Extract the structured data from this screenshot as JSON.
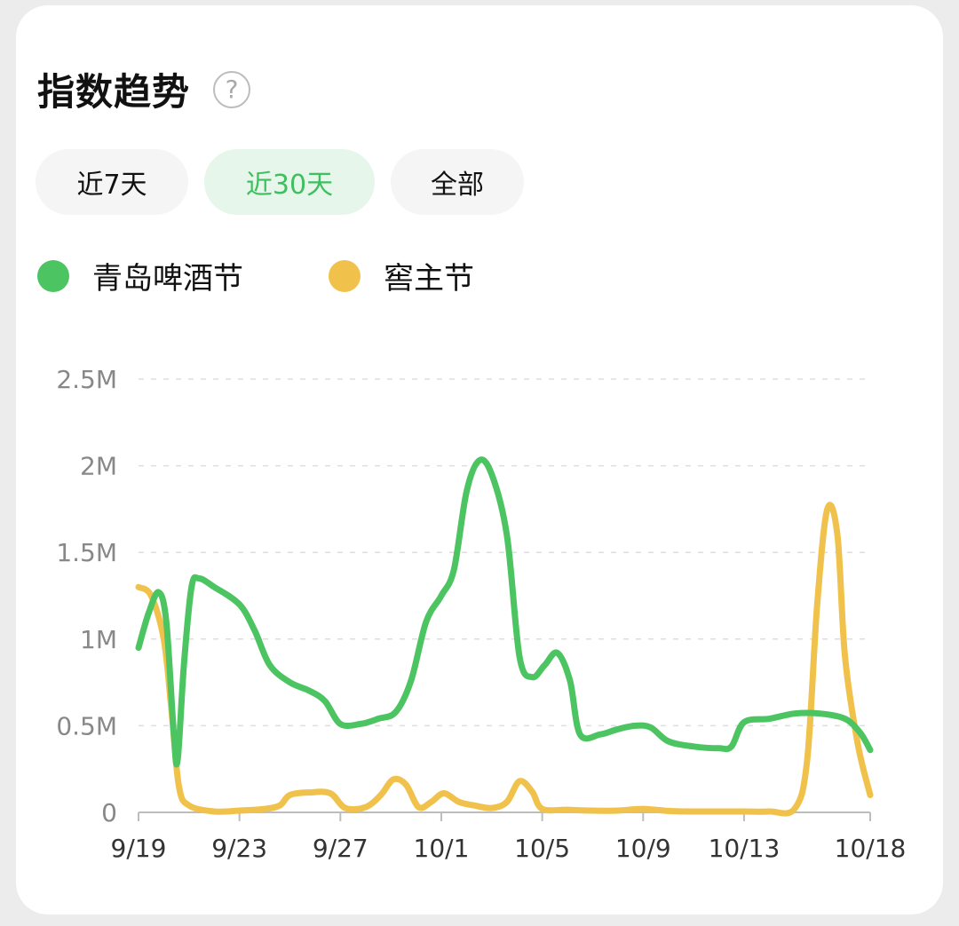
{
  "header": {
    "title": "指数趋势",
    "help_symbol": "?"
  },
  "tabs": [
    {
      "label": "近7天",
      "active": false
    },
    {
      "label": "近30天",
      "active": true
    },
    {
      "label": "全部",
      "active": false
    }
  ],
  "colors": {
    "green": "#4cc461",
    "yellow": "#f0c24b",
    "active_tab_text": "#3fbf5f"
  },
  "chart_data": {
    "type": "line",
    "y_ticks": [
      "0",
      "0.5M",
      "1M",
      "1.5M",
      "2M",
      "2.5M"
    ],
    "y_tick_values": [
      0,
      500000,
      1000000,
      1500000,
      2000000,
      2500000
    ],
    "ylim": [
      0,
      2500000
    ],
    "x_ticks": [
      "9/19",
      "9/23",
      "9/27",
      "10/1",
      "10/5",
      "10/9",
      "10/13",
      "10/18"
    ],
    "x_tick_days": [
      0,
      4,
      8,
      12,
      16,
      20,
      24,
      29
    ],
    "xlim": [
      0,
      29
    ],
    "grid": true,
    "legend_position": "top-left",
    "series": [
      {
        "name": "青岛啤酒节",
        "color": "#4cc461",
        "points": [
          [
            0,
            950000
          ],
          [
            0.4,
            1150000
          ],
          [
            0.8,
            1270000
          ],
          [
            1.1,
            1100000
          ],
          [
            1.4,
            450000
          ],
          [
            1.55,
            300000
          ],
          [
            1.8,
            850000
          ],
          [
            2.1,
            1300000
          ],
          [
            2.4,
            1350000
          ],
          [
            3,
            1300000
          ],
          [
            4,
            1200000
          ],
          [
            4.6,
            1050000
          ],
          [
            5.2,
            850000
          ],
          [
            6,
            750000
          ],
          [
            6.8,
            700000
          ],
          [
            7.4,
            640000
          ],
          [
            8,
            510000
          ],
          [
            8.8,
            510000
          ],
          [
            9.5,
            540000
          ],
          [
            10.2,
            580000
          ],
          [
            10.8,
            760000
          ],
          [
            11.4,
            1100000
          ],
          [
            12,
            1250000
          ],
          [
            12.5,
            1400000
          ],
          [
            13,
            1850000
          ],
          [
            13.5,
            2030000
          ],
          [
            14,
            1950000
          ],
          [
            14.6,
            1600000
          ],
          [
            15.1,
            900000
          ],
          [
            15.6,
            780000
          ],
          [
            16.1,
            850000
          ],
          [
            16.6,
            920000
          ],
          [
            17.1,
            760000
          ],
          [
            17.5,
            450000
          ],
          [
            18.3,
            450000
          ],
          [
            19,
            480000
          ],
          [
            19.7,
            500000
          ],
          [
            20.3,
            490000
          ],
          [
            21,
            410000
          ],
          [
            22,
            380000
          ],
          [
            23,
            370000
          ],
          [
            23.5,
            380000
          ],
          [
            24,
            520000
          ],
          [
            25,
            540000
          ],
          [
            26,
            570000
          ],
          [
            27,
            570000
          ],
          [
            28,
            540000
          ],
          [
            28.6,
            460000
          ],
          [
            29,
            360000
          ]
        ]
      },
      {
        "name": "窖主节",
        "color": "#f0c24b",
        "points": [
          [
            0,
            1300000
          ],
          [
            0.5,
            1250000
          ],
          [
            1,
            1000000
          ],
          [
            1.3,
            600000
          ],
          [
            1.6,
            150000
          ],
          [
            2,
            40000
          ],
          [
            3,
            5000
          ],
          [
            4,
            10000
          ],
          [
            5,
            20000
          ],
          [
            5.6,
            40000
          ],
          [
            6,
            100000
          ],
          [
            6.8,
            115000
          ],
          [
            7.6,
            110000
          ],
          [
            8.2,
            25000
          ],
          [
            9,
            30000
          ],
          [
            9.6,
            100000
          ],
          [
            10.1,
            190000
          ],
          [
            10.6,
            160000
          ],
          [
            11.1,
            30000
          ],
          [
            11.6,
            60000
          ],
          [
            12.1,
            110000
          ],
          [
            12.7,
            60000
          ],
          [
            13.3,
            40000
          ],
          [
            14,
            25000
          ],
          [
            14.6,
            60000
          ],
          [
            15.1,
            180000
          ],
          [
            15.6,
            120000
          ],
          [
            16,
            20000
          ],
          [
            17,
            15000
          ],
          [
            18,
            10000
          ],
          [
            19,
            10000
          ],
          [
            20,
            20000
          ],
          [
            21,
            8000
          ],
          [
            22,
            5000
          ],
          [
            23,
            5000
          ],
          [
            24,
            5000
          ],
          [
            25,
            5000
          ],
          [
            26,
            20000
          ],
          [
            26.5,
            300000
          ],
          [
            26.9,
            1200000
          ],
          [
            27.3,
            1750000
          ],
          [
            27.7,
            1600000
          ],
          [
            28,
            900000
          ],
          [
            28.5,
            400000
          ],
          [
            29,
            100000
          ]
        ]
      }
    ]
  }
}
